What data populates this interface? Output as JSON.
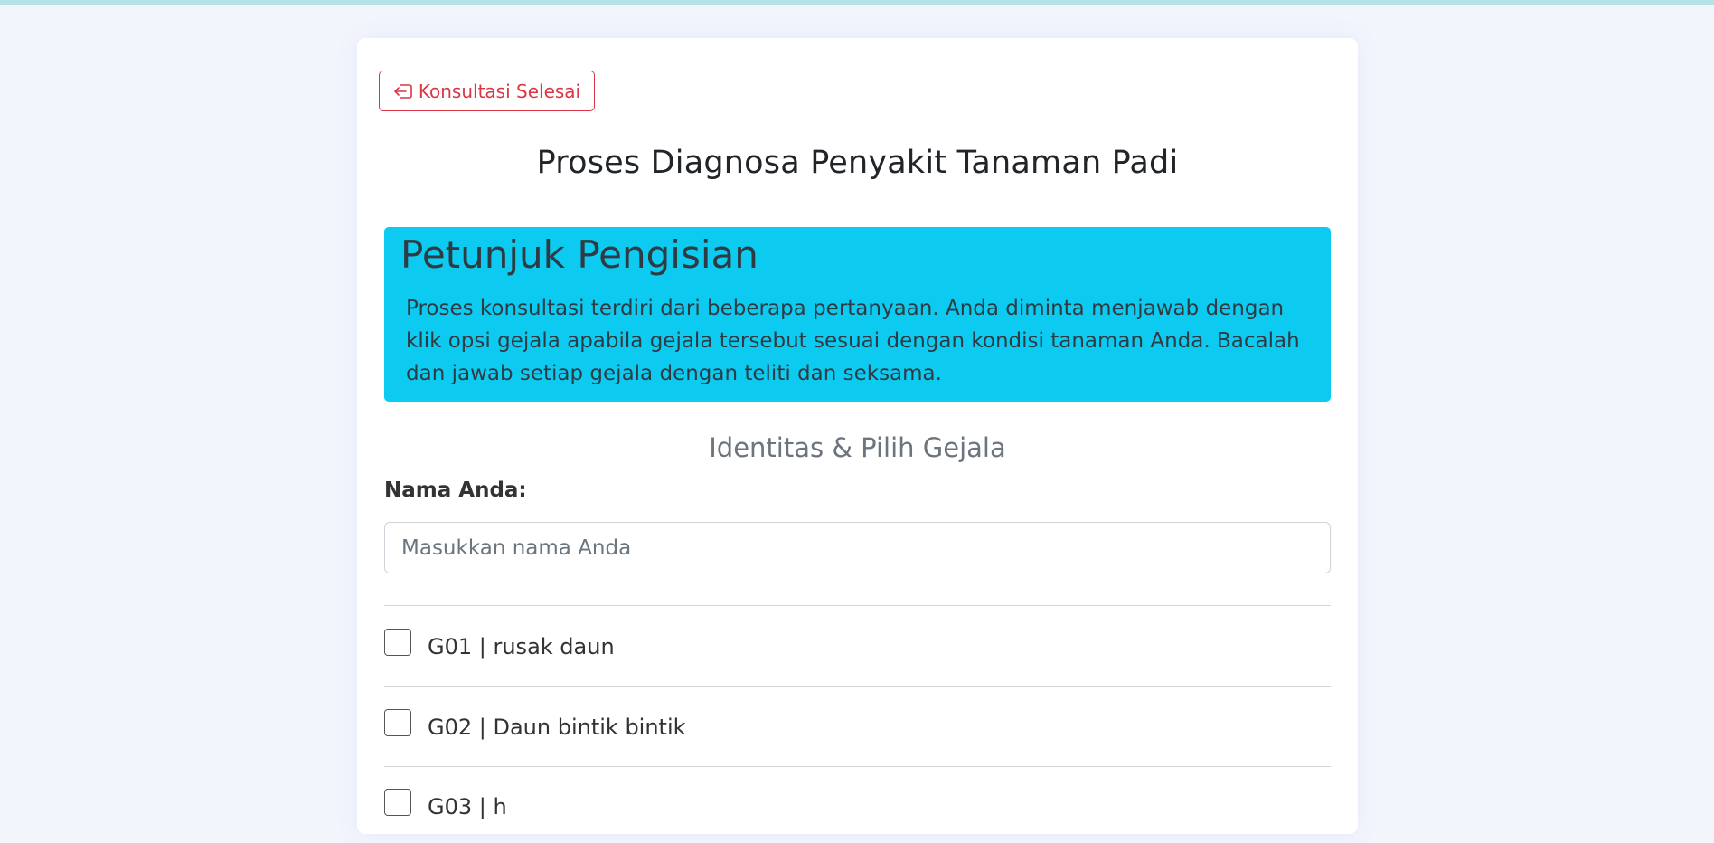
{
  "header": {
    "done_button_label": "Konsultasi Selesai",
    "done_button_icon": "box-arrow-left-icon",
    "title": "Proses Diagnosa Penyakit Tanaman Padi"
  },
  "instructions": {
    "title": "Petunjuk Pengisian",
    "text": "Proses konsultasi terdiri dari beberapa pertanyaan. Anda diminta menjawab dengan klik opsi gejala apabila gejala tersebut sesuai dengan kondisi tanaman Anda. Bacalah dan jawab setiap gejala dengan teliti dan seksama.",
    "background_color": "#0dcaf0"
  },
  "form": {
    "section_title": "Identitas & Pilih Gejala",
    "name_label": "Nama Anda:",
    "name_value": "",
    "name_placeholder": "Masukkan nama Anda",
    "symptoms": [
      {
        "label": "G01 | rusak daun",
        "checked": false
      },
      {
        "label": "G02 | Daun bintik bintik",
        "checked": false
      },
      {
        "label": "G03 | h",
        "checked": false
      }
    ]
  },
  "colors": {
    "accent_danger": "#dc3545",
    "info": "#0dcaf0",
    "page_background": "#f3f5fd"
  }
}
